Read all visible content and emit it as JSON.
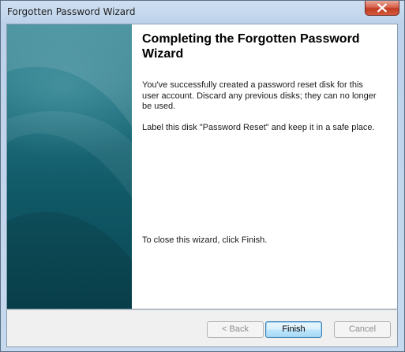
{
  "window": {
    "title": "Forgotten Password Wizard",
    "close_icon": "close-icon"
  },
  "wizard": {
    "heading": "Completing the Forgotten Password Wizard",
    "paragraph1": "You've successfully created a password reset disk for this user account. Discard any previous disks; they can no longer be used.",
    "paragraph2": "Label this disk \"Password Reset\" and keep it in a safe place.",
    "paragraph3": "To close this wizard, click Finish."
  },
  "buttons": {
    "back": {
      "label": "< Back",
      "enabled": false
    },
    "finish": {
      "label": "Finish",
      "enabled": true,
      "default": true
    },
    "cancel": {
      "label": "Cancel",
      "enabled": false
    }
  },
  "colors": {
    "banner_teal": "#105866",
    "close_red": "#c13c22",
    "default_button_border": "#3c7fb1"
  }
}
